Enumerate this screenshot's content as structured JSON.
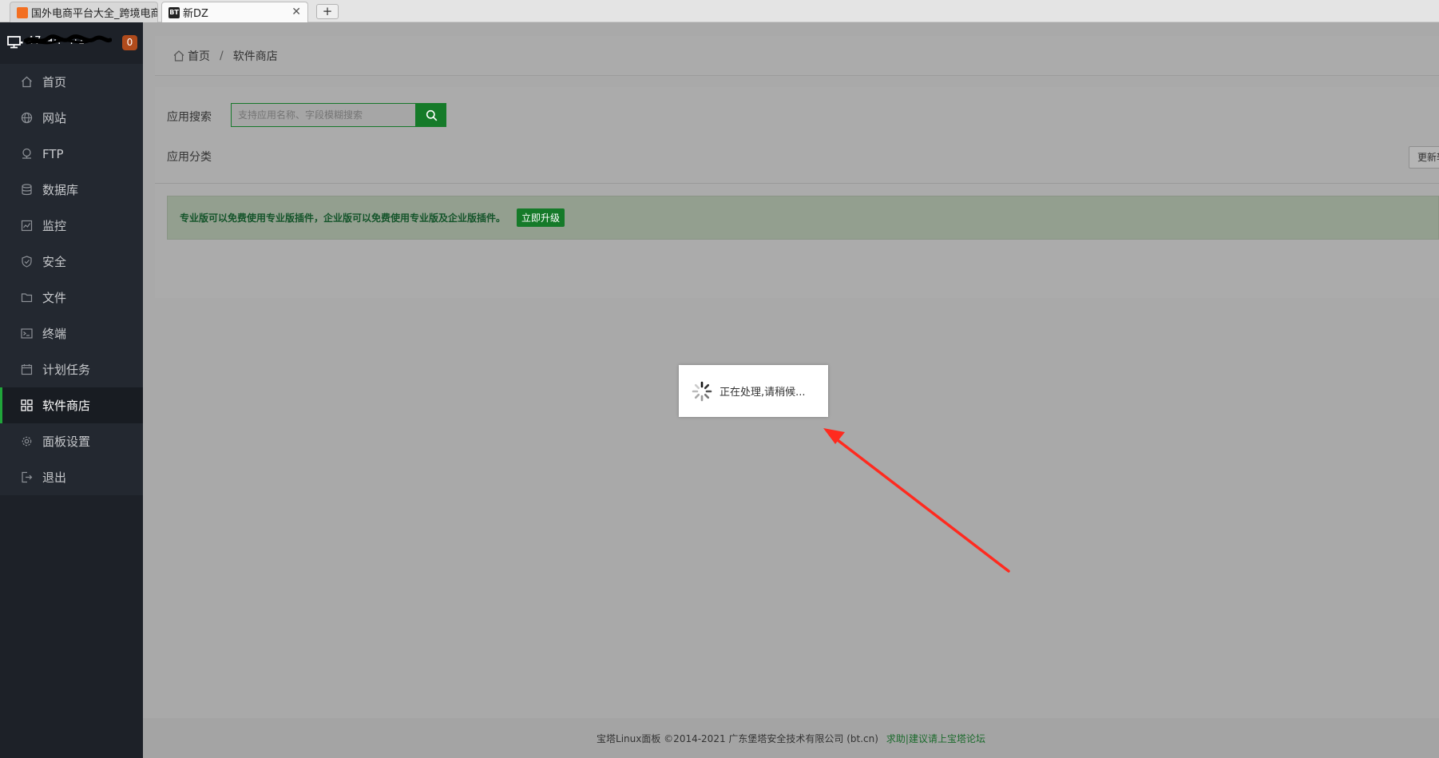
{
  "browser": {
    "tabs": [
      {
        "title": "国外电商平台大全_跨境电商",
        "icon": "store-favicon",
        "active": false
      },
      {
        "title": "新DZ",
        "icon": "bt-favicon",
        "favicon_text": "BT",
        "active": true
      }
    ],
    "close_glyph": "✕",
    "new_tab_glyph": "+"
  },
  "sidebar": {
    "server_address": "47.9·.··.·1",
    "badge_count": "0",
    "items": [
      {
        "label": "首页",
        "icon": "home-icon"
      },
      {
        "label": "网站",
        "icon": "globe-icon"
      },
      {
        "label": "FTP",
        "icon": "ftp-icon"
      },
      {
        "label": "数据库",
        "icon": "database-icon"
      },
      {
        "label": "监控",
        "icon": "monitor-chart-icon"
      },
      {
        "label": "安全",
        "icon": "shield-icon"
      },
      {
        "label": "文件",
        "icon": "folder-icon"
      },
      {
        "label": "终端",
        "icon": "terminal-icon"
      },
      {
        "label": "计划任务",
        "icon": "calendar-icon"
      },
      {
        "label": "软件商店",
        "icon": "apps-grid-icon",
        "active": true
      },
      {
        "label": "面板设置",
        "icon": "gear-icon"
      },
      {
        "label": "退出",
        "icon": "logout-icon"
      }
    ]
  },
  "breadcrumb": {
    "home": "首页",
    "separator": "/",
    "current": "软件商店"
  },
  "store": {
    "search_label": "应用搜索",
    "search_placeholder": "支持应用名称、字段模糊搜索",
    "category_label": "应用分类",
    "update_button": "更新软件列表",
    "notice_text": "专业版可以免费使用专业版插件，企业版可以免费使用专业版及企业版插件。",
    "upgrade_button": "立即升级"
  },
  "loading": {
    "text": "正在处理,请稍候..."
  },
  "footer": {
    "copyright": "宝塔Linux面板 ©2014-2021 广东堡塔安全技术有限公司 (bt.cn)",
    "link": "求助|建议请上宝塔论坛"
  },
  "colors": {
    "accent_green": "#20a53a",
    "annotation_arrow": "#ff2a1f",
    "badge": "#b04b1c"
  }
}
